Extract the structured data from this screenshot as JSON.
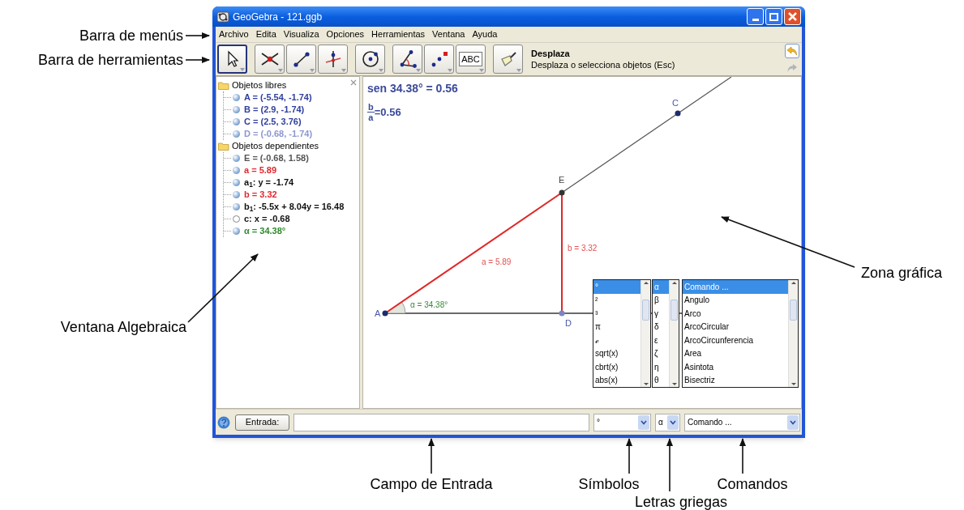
{
  "annotations": [
    {
      "text": "Barra de menús"
    },
    {
      "text": "Barra de herramientas"
    },
    {
      "text": "Ventana Algebraica"
    },
    {
      "text": "Zona gráfica"
    },
    {
      "text": "Campo de Entrada"
    },
    {
      "text": "Símbolos"
    },
    {
      "text": "Letras griegas"
    },
    {
      "text": "Comandos"
    }
  ],
  "window": {
    "title": "GeoGebra - 121.ggb"
  },
  "menu": [
    "Archivo",
    "Edita",
    "Visualiza",
    "Opciones",
    "Herramientas",
    "Ventana",
    "Ayuda"
  ],
  "toolbar": {
    "groups": [
      {
        "tools": [
          {
            "kind": "move",
            "selected": true
          }
        ]
      },
      {
        "tools": [
          {
            "kind": "intersect",
            "selected": false
          },
          {
            "kind": "segment",
            "selected": false
          },
          {
            "kind": "perpendicular",
            "selected": false
          }
        ]
      },
      {
        "tools": [
          {
            "kind": "circle",
            "selected": false
          }
        ]
      },
      {
        "tools": [
          {
            "kind": "angle",
            "selected": false
          },
          {
            "kind": "points",
            "selected": false
          },
          {
            "kind": "text",
            "label": "ABC",
            "selected": false
          }
        ]
      },
      {
        "tools": [
          {
            "kind": "brush",
            "selected": false
          }
        ]
      }
    ],
    "tool_name": "Desplaza",
    "tool_help": "Desplaza o selecciona objetos (Esc)"
  },
  "algebra_view": {
    "groups": [
      {
        "label": "Objetos libres",
        "items": [
          {
            "text": "A = (-5.54, -1.74)",
            "color": "#2f3f9e",
            "shown": true
          },
          {
            "text": "B = (2.9, -1.74)",
            "color": "#2f3f9e",
            "shown": true
          },
          {
            "text": "C = (2.5, 3.76)",
            "color": "#2f3f9e",
            "shown": true
          },
          {
            "text": "D = (-0.68, -1.74)",
            "color": "#8d97d0",
            "shown": true
          }
        ]
      },
      {
        "label": "Objetos dependientes",
        "items": [
          {
            "text": "E = (-0.68, 1.58)",
            "color": "#555555",
            "shown": true
          },
          {
            "text": "a = 5.89",
            "color": "#e0282e",
            "shown": true
          },
          {
            "text": "a$_{1}$: y = -1.74",
            "color": "#111111",
            "shown": true
          },
          {
            "text": "b = 3.32",
            "color": "#e0282e",
            "shown": true
          },
          {
            "text": "b$_{1}$: -5.5x + 8.04y = 16.48",
            "color": "#111111",
            "shown": true
          },
          {
            "text": "c: x = -0.68",
            "color": "#111111",
            "shown": false
          },
          {
            "text": "α = 34.38°",
            "color": "#2e8a2e",
            "shown": true
          }
        ]
      }
    ]
  },
  "graphics": {
    "caption": "sen 34.38° = 0.56",
    "fraction": {
      "numerator": "b",
      "denominator": "a",
      "value": "=0.56"
    },
    "points": [
      "A",
      "D",
      "E",
      "C"
    ],
    "segment_labels": [
      "a = 5.89",
      "b = 3.32"
    ],
    "angle_label": "α = 34.38°"
  },
  "input_bar": {
    "button": "Entrada:",
    "symbols": {
      "value": "°",
      "options": [
        {
          "text": "°",
          "selected": true
        },
        {
          "text": "²",
          "selected": false
        },
        {
          "text": "³",
          "selected": false
        },
        {
          "text": "π",
          "selected": false
        },
        {
          "text": "ℯ",
          "selected": false
        },
        {
          "text": "sqrt(x)",
          "selected": false
        },
        {
          "text": "cbrt(x)",
          "selected": false
        },
        {
          "text": "abs(x)",
          "selected": false
        }
      ]
    },
    "greek": {
      "value": "α",
      "options": [
        {
          "text": "α",
          "selected": true
        },
        {
          "text": "β",
          "selected": false
        },
        {
          "text": "γ",
          "selected": false
        },
        {
          "text": "δ",
          "selected": false
        },
        {
          "text": "ε",
          "selected": false
        },
        {
          "text": "ζ",
          "selected": false
        },
        {
          "text": "η",
          "selected": false
        },
        {
          "text": "θ",
          "selected": false
        }
      ]
    },
    "commands": {
      "value": "Comando ...",
      "options": [
        {
          "text": "Comando ...",
          "selected": true
        },
        {
          "text": "Angulo",
          "selected": false
        },
        {
          "text": "Arco",
          "selected": false
        },
        {
          "text": "ArcoCircular",
          "selected": false
        },
        {
          "text": "ArcoCircunferencia",
          "selected": false
        },
        {
          "text": "Area",
          "selected": false
        },
        {
          "text": "Asintota",
          "selected": false
        },
        {
          "text": "Bisectriz",
          "selected": false
        }
      ]
    }
  }
}
